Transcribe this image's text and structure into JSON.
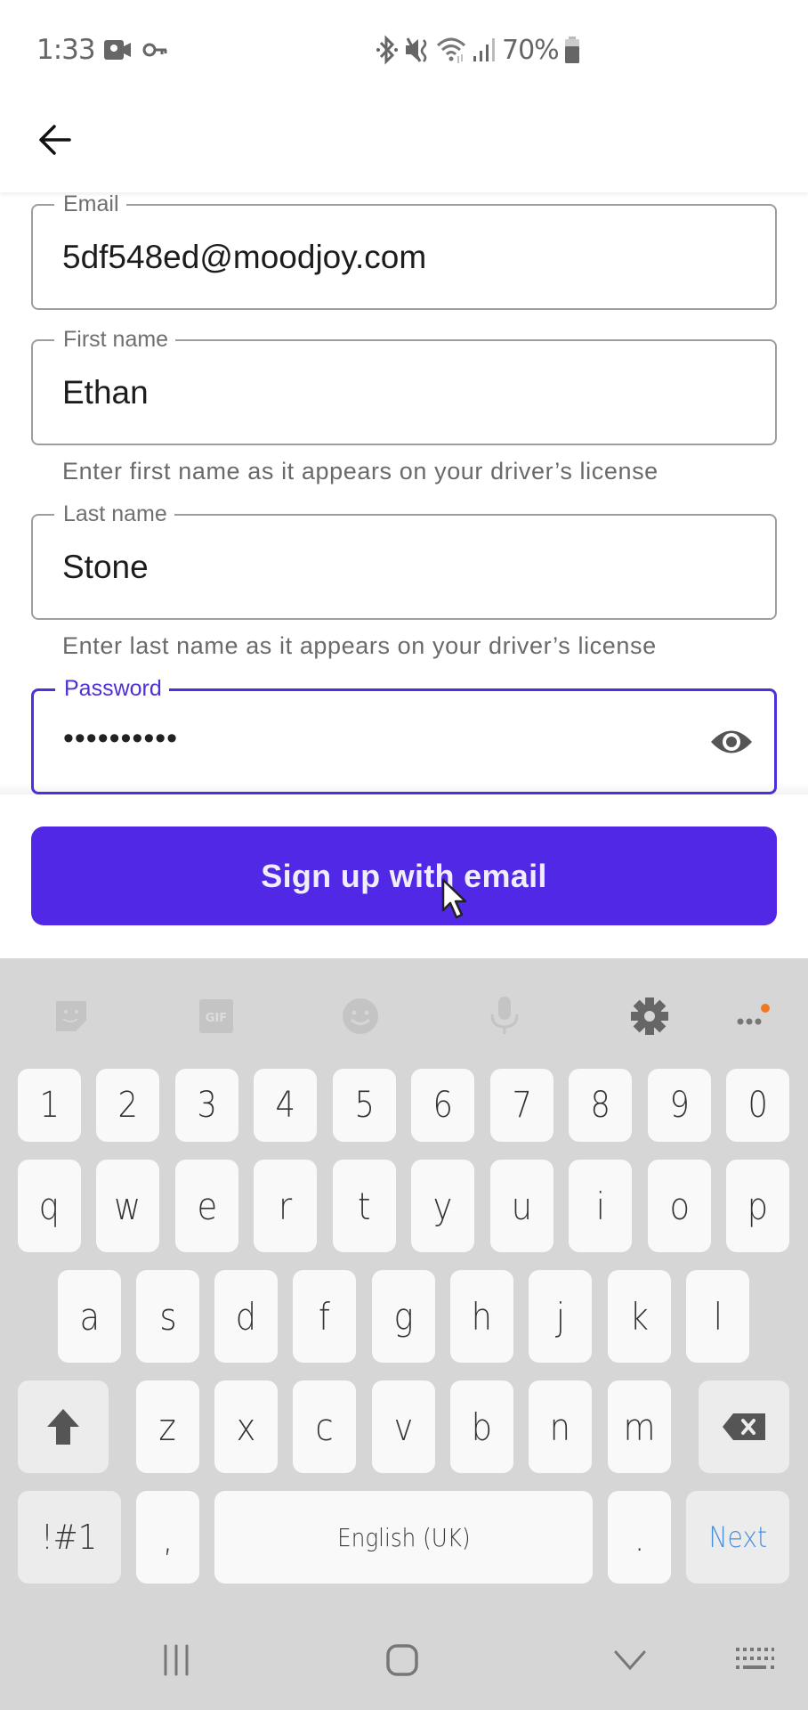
{
  "status_bar": {
    "time": "1:33",
    "left_icons": [
      "video-recording-icon",
      "vpn-key-icon"
    ],
    "right_icons": [
      "bluetooth-icon",
      "mute-vibrate-icon",
      "wifi-icon",
      "signal-icon",
      "battery-icon"
    ],
    "battery": "70%"
  },
  "header": {
    "back_icon": "arrow-left-icon"
  },
  "form": {
    "email": {
      "label": "Email",
      "value": "5df548ed@moodjoy.com"
    },
    "first_name": {
      "label": "First name",
      "value": "Ethan",
      "helper": "Enter first name as it appears on your driver’s license"
    },
    "last_name": {
      "label": "Last name",
      "value": "Stone",
      "helper": "Enter last name as it appears on your driver’s license"
    },
    "password": {
      "label": "Password",
      "masked_value": "••••••••••",
      "visibility_icon": "eye-icon",
      "focused": true
    }
  },
  "primary_button": {
    "label": "Sign up with email"
  },
  "colors": {
    "accent": "#5128e6",
    "focused_border": "#4f2fd8",
    "keyboard_bg": "#d6d6d6",
    "next_key": "#4a90d9",
    "notification_dot": "#f07a24"
  },
  "keyboard": {
    "toolbar": [
      "sticker-icon",
      "gif-icon",
      "emoji-icon",
      "microphone-icon",
      "settings-gear-icon",
      "more-options-icon"
    ],
    "rows": {
      "numbers": [
        "1",
        "2",
        "3",
        "4",
        "5",
        "6",
        "7",
        "8",
        "9",
        "0"
      ],
      "row1": [
        "q",
        "w",
        "e",
        "r",
        "t",
        "y",
        "u",
        "i",
        "o",
        "p"
      ],
      "row2": [
        "a",
        "s",
        "d",
        "f",
        "g",
        "h",
        "j",
        "k",
        "l"
      ],
      "row3": [
        "z",
        "x",
        "c",
        "v",
        "b",
        "n",
        "m"
      ]
    },
    "symbols_key": "!#1",
    "comma_key": ",",
    "space_label": "English (UK)",
    "period_key": ".",
    "action_key": "Next"
  },
  "nav_bar": {
    "buttons": [
      "recent-apps-icon",
      "home-icon",
      "hide-keyboard-icon",
      "keyboard-switch-icon"
    ]
  }
}
